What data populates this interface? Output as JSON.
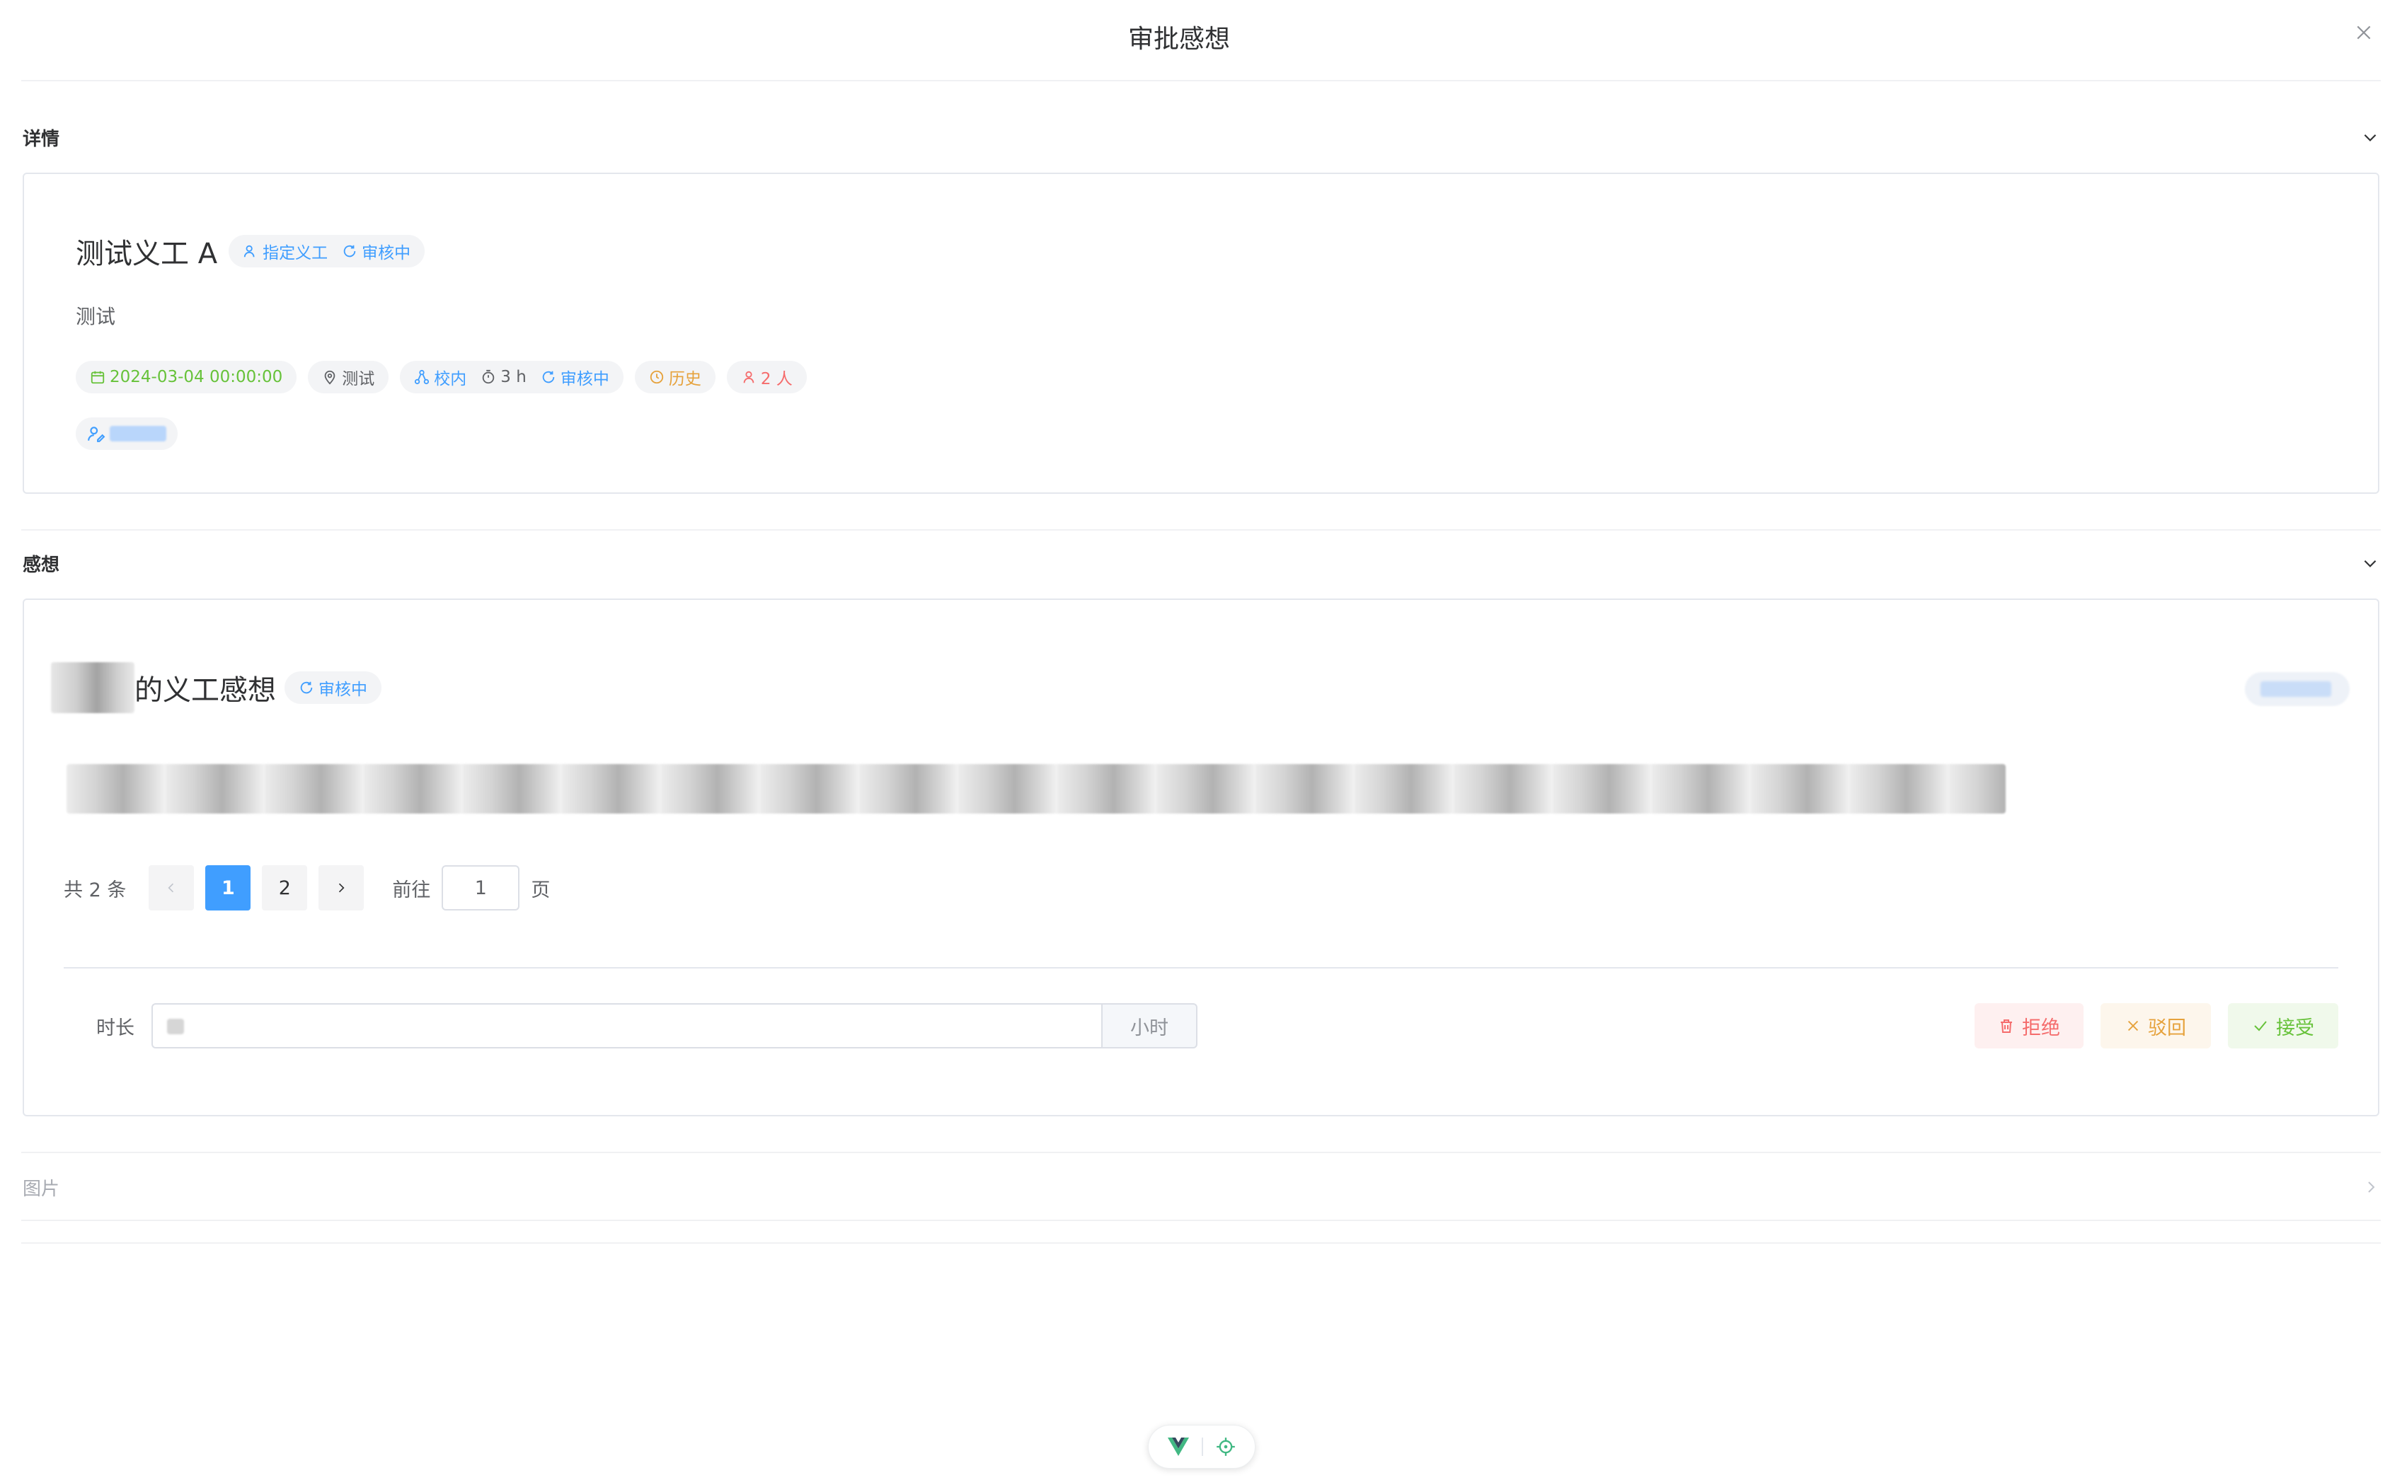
{
  "dialog": {
    "title": "审批感想"
  },
  "details": {
    "section_title": "详情",
    "activity_title": "测试义工 A",
    "title_tags": {
      "assign": "指定义工",
      "status": "审核中"
    },
    "description": "测试",
    "meta": {
      "date": "2024-03-04 00:00:00",
      "location": "测试",
      "scope": "校内",
      "duration": "3 h",
      "status": "审核中",
      "history": "历史",
      "people": "2 人"
    }
  },
  "reflection": {
    "section_title": "感想",
    "title_suffix": "的义工感想",
    "status_tag": "审核中",
    "pagination": {
      "total_text": "共 2 条",
      "pages": [
        "1",
        "2"
      ],
      "current": "1",
      "goto_label": "前往",
      "goto_value": "1",
      "page_unit": "页"
    },
    "duration_label": "时长",
    "duration_unit": "小时",
    "actions": {
      "reject": "拒绝",
      "return": "驳回",
      "accept": "接受"
    }
  },
  "images": {
    "section_title": "图片"
  },
  "colors": {
    "primary": "#409eff",
    "success": "#67c23a",
    "warning": "#e6a23c",
    "danger": "#f56c6c"
  },
  "icons": [
    "close-icon",
    "chevron-down-icon",
    "chevron-right-icon",
    "user-icon",
    "refresh-icon",
    "calendar-icon",
    "location-icon",
    "share-icon",
    "timer-icon",
    "clock-icon",
    "user-edit-icon",
    "trash-icon",
    "x-icon",
    "check-icon",
    "vue-logo-icon",
    "target-icon"
  ]
}
